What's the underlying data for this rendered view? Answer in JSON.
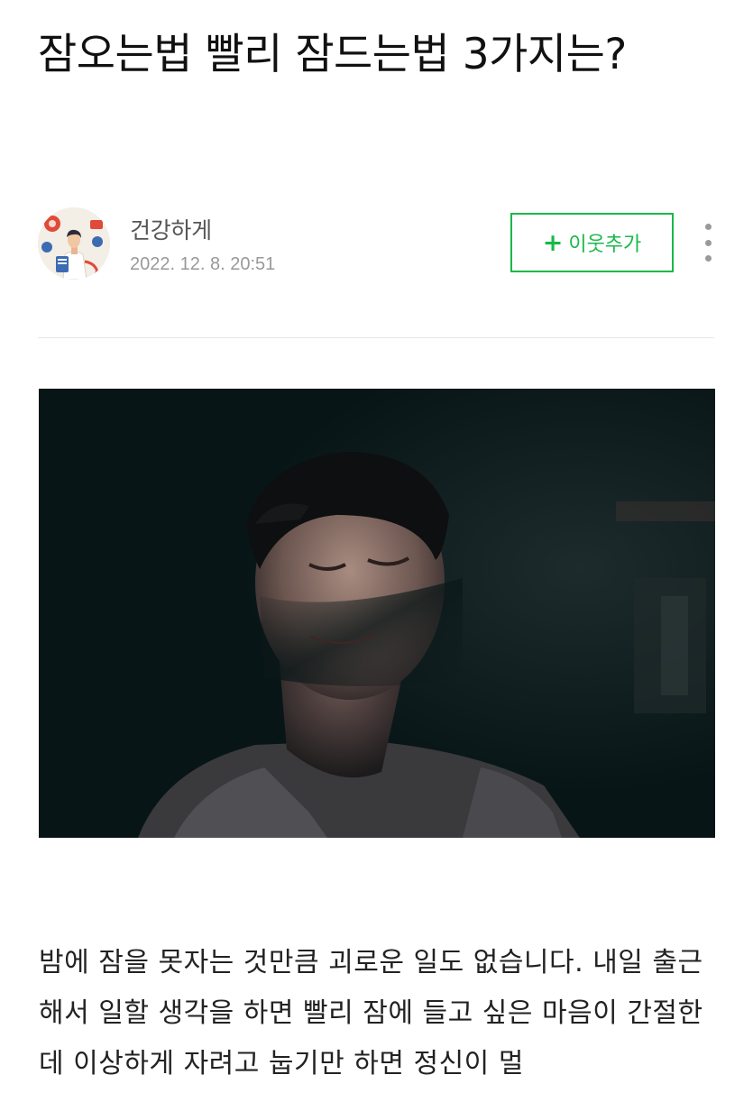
{
  "post": {
    "title": "잠오는법 빨리 잠드는법 3가지는?",
    "author_name": "건강하게",
    "date": "2022. 12. 8. 20:51",
    "add_neighbor_plus": "+",
    "add_neighbor_label": "이웃추가",
    "body": "밤에 잠을 못자는 것만큼 괴로운 일도 없습니다. 내일 출근해서 일할 생각을 하면 빨리 잠에 들고 싶은 마음이 간절한데 이상하게 자려고 눕기만 하면 정신이 멀"
  },
  "icons": {
    "more": "vertical-ellipsis-icon",
    "avatar": "doctor-illustration-avatar"
  },
  "colors": {
    "accent": "#19b84a",
    "text": "#111111",
    "meta": "#999999",
    "photo_bg": "#081517"
  }
}
